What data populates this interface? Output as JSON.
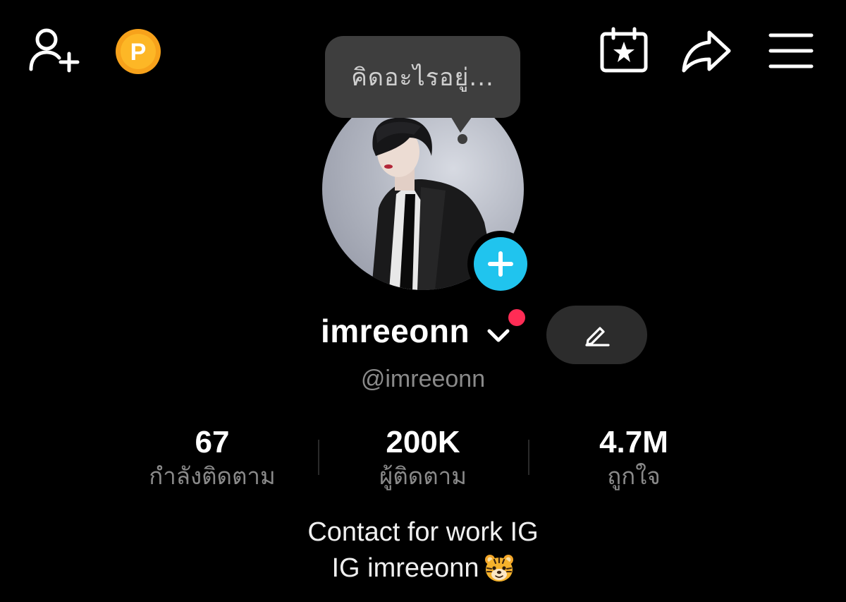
{
  "header": {
    "icons": [
      "add-user-icon",
      "coin-p-icon",
      "calendar-star-icon",
      "share-arrow-icon",
      "menu-icon"
    ],
    "coin_letter": "P"
  },
  "profile": {
    "thought_placeholder": "คิดอะไรอยู่...",
    "username": "imreeonn",
    "handle": "@imreeonn"
  },
  "stats": [
    {
      "value": "67",
      "label": "กำลังติดตาม"
    },
    {
      "value": "200K",
      "label": "ผู้ติดตาม"
    },
    {
      "value": "4.7M",
      "label": "ถูกใจ"
    }
  ],
  "bio": {
    "line1": "Contact for work IG",
    "line2": "IG imreeonn"
  },
  "colors": {
    "background": "#000000",
    "accent_blue": "#20c4ee",
    "notification_red": "#ff2c55",
    "coin_orange": "#f7a21b",
    "muted_text": "#8a8a8a"
  }
}
